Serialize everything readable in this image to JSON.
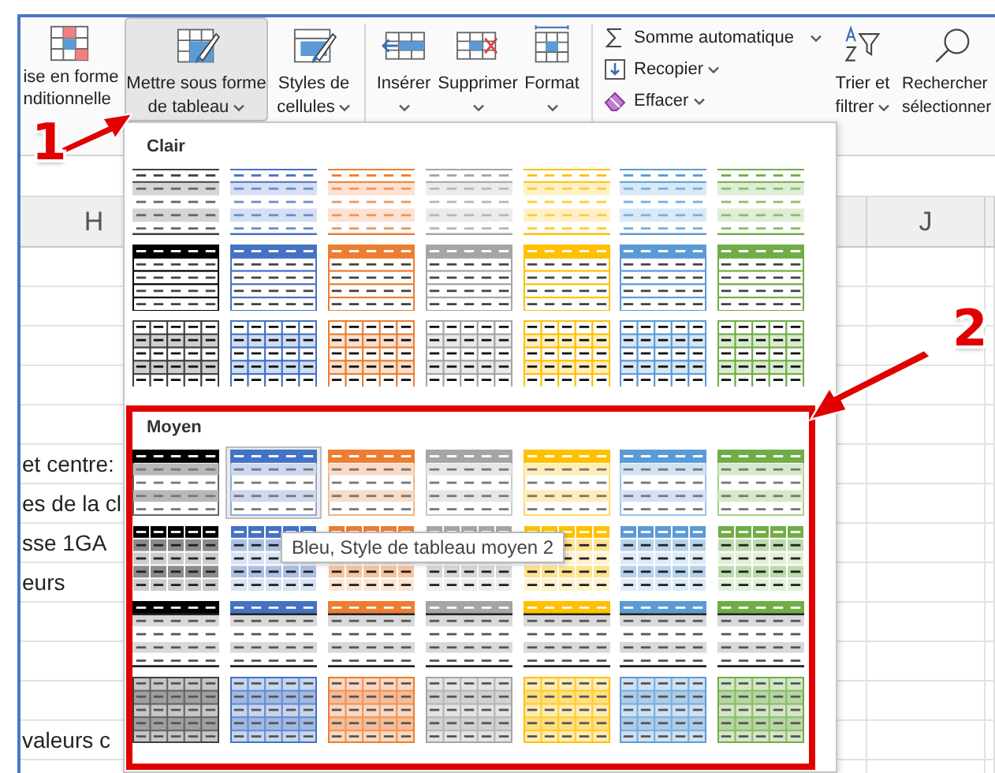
{
  "ribbon": {
    "large_buttons": [
      {
        "label_lines": [
          "ise en forme",
          "nditionnelle"
        ],
        "dropdown": false,
        "pressed": false
      },
      {
        "label_lines": [
          "Mettre sous forme",
          "de tableau"
        ],
        "dropdown": true,
        "pressed": true
      },
      {
        "label_lines": [
          "Styles de",
          "cellules"
        ],
        "dropdown": true,
        "pressed": false
      }
    ],
    "cell_buttons": [
      {
        "label": "Insérer",
        "dropdown": true
      },
      {
        "label": "Supprimer",
        "dropdown": true
      },
      {
        "label": "Format",
        "dropdown": true
      }
    ],
    "editing_small": [
      {
        "label": "Somme automatique",
        "dropdown": true
      },
      {
        "label": "Recopier",
        "dropdown": true
      },
      {
        "label": "Effacer",
        "dropdown": true
      }
    ],
    "editing_large": [
      {
        "label_lines": [
          "Trier et",
          "filtrer"
        ],
        "dropdown": true
      },
      {
        "label_lines": [
          "Rechercher",
          "sélectionner"
        ],
        "dropdown": false
      }
    ]
  },
  "sheet": {
    "column_headers": [
      {
        "label": "H"
      },
      {
        "label": "J"
      }
    ],
    "rows": [
      {},
      {},
      {},
      {},
      {},
      {
        "column_h": "et centre:"
      },
      {
        "column_h": "es de la cl"
      },
      {
        "column_h": "sse 1GA"
      },
      {
        "column_h": "eurs"
      },
      {},
      {},
      {},
      {
        "column_h": "valeurs c"
      },
      {}
    ]
  },
  "gallery": {
    "sections": [
      {
        "title": "Clair",
        "rows": [
          {
            "kind": "banded",
            "styles": [
              {
                "color": "#404040",
                "selected": false
              },
              {
                "color": "#4472c4",
                "selected": false
              },
              {
                "color": "#ed7d31",
                "selected": false
              },
              {
                "color": "#a5a5a5",
                "selected": false
              },
              {
                "color": "#ffc000",
                "selected": false
              },
              {
                "color": "#5b9bd5",
                "selected": false
              },
              {
                "color": "#70ad47",
                "selected": false
              }
            ]
          },
          {
            "kind": "bordered",
            "styles": [
              {
                "color": "#000000",
                "selected": false
              },
              {
                "color": "#4472c4",
                "selected": false
              },
              {
                "color": "#ed7d31",
                "selected": false
              },
              {
                "color": "#a5a5a5",
                "selected": false
              },
              {
                "color": "#ffc000",
                "selected": false
              },
              {
                "color": "#5b9bd5",
                "selected": false
              },
              {
                "color": "#70ad47",
                "selected": false
              }
            ]
          },
          {
            "kind": "grid",
            "styles": [
              {
                "color": "#404040",
                "selected": false
              },
              {
                "color": "#4472c4",
                "selected": false
              },
              {
                "color": "#ed7d31",
                "selected": false
              },
              {
                "color": "#a5a5a5",
                "selected": false
              },
              {
                "color": "#ffc000",
                "selected": false
              },
              {
                "color": "#5b9bd5",
                "selected": false
              },
              {
                "color": "#70ad47",
                "selected": false
              }
            ]
          }
        ]
      },
      {
        "title": "Moyen",
        "rows": [
          {
            "kind": "header-banded",
            "styles": [
              {
                "color": "#000000",
                "selected": false
              },
              {
                "color": "#4472c4",
                "selected": true
              },
              {
                "color": "#ed7d31",
                "selected": false
              },
              {
                "color": "#a5a5a5",
                "selected": false
              },
              {
                "color": "#ffc000",
                "selected": false
              },
              {
                "color": "#5b9bd5",
                "selected": false
              },
              {
                "color": "#70ad47",
                "selected": false
              }
            ]
          },
          {
            "kind": "header-grid",
            "styles": [
              {
                "color": "#000000",
                "selected": false
              },
              {
                "color": "#4472c4",
                "selected": false
              },
              {
                "color": "#ed7d31",
                "selected": false
              },
              {
                "color": "#a5a5a5",
                "selected": false
              },
              {
                "color": "#ffc000",
                "selected": false
              },
              {
                "color": "#5b9bd5",
                "selected": false
              },
              {
                "color": "#70ad47",
                "selected": false
              }
            ]
          },
          {
            "kind": "bar-header",
            "styles": [
              {
                "color": "#000000",
                "selected": false
              },
              {
                "color": "#4472c4",
                "selected": false
              },
              {
                "color": "#ed7d31",
                "selected": false
              },
              {
                "color": "#a5a5a5",
                "selected": false
              },
              {
                "color": "#ffc000",
                "selected": false
              },
              {
                "color": "#5b9bd5",
                "selected": false
              },
              {
                "color": "#70ad47",
                "selected": false
              }
            ]
          },
          {
            "kind": "tinted-grid",
            "styles": [
              {
                "color": "#404040",
                "selected": false
              },
              {
                "color": "#4472c4",
                "selected": false
              },
              {
                "color": "#ed7d31",
                "selected": false
              },
              {
                "color": "#a5a5a5",
                "selected": false
              },
              {
                "color": "#ffc000",
                "selected": false
              },
              {
                "color": "#5b9bd5",
                "selected": false
              },
              {
                "color": "#70ad47",
                "selected": false
              }
            ]
          }
        ]
      }
    ],
    "tooltip": "Bleu, Style de tableau moyen 2"
  },
  "callouts": [
    {
      "number": "1"
    },
    {
      "number": "2"
    }
  ]
}
